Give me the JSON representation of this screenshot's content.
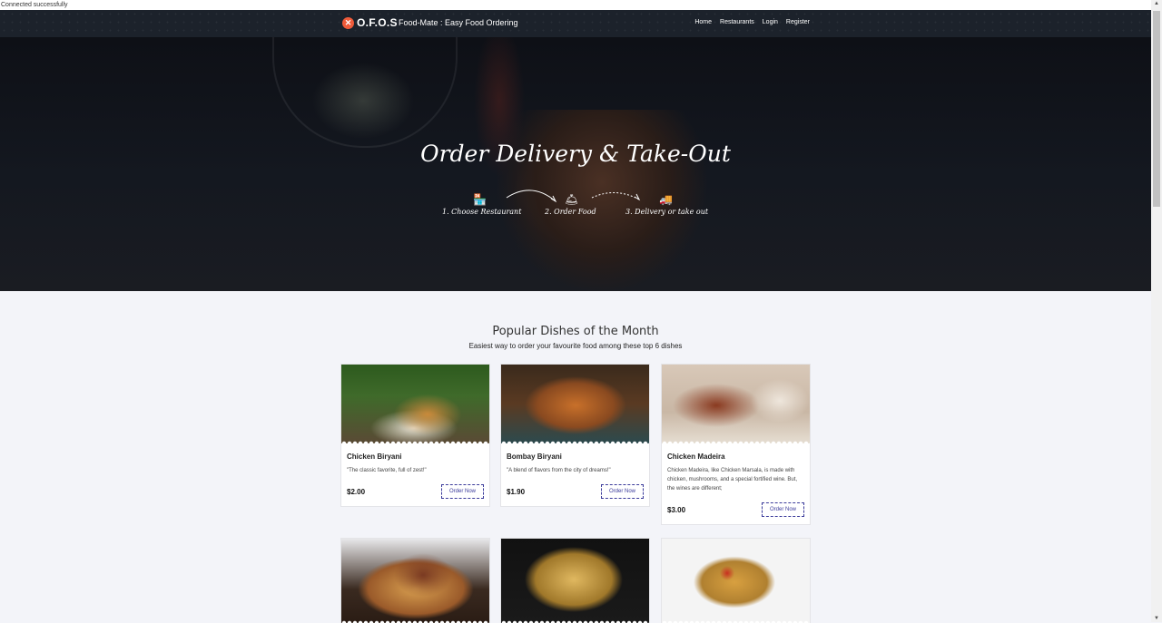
{
  "status": "Connected successfully",
  "brand": {
    "logo_text": "O.F.O.S",
    "title": "Food-Mate : Easy Food Ordering"
  },
  "nav": [
    "Home",
    "Restaurants",
    "Login",
    "Register"
  ],
  "hero": {
    "title": "Order Delivery & Take-Out",
    "steps": [
      "1. Choose Restaurant",
      "2. Order Food",
      "3. Delivery or take out"
    ]
  },
  "section": {
    "title": "Popular Dishes of the Month",
    "subtitle": "Easiest way to order your favourite food among these top 6 dishes"
  },
  "dishes": [
    {
      "name": "Chicken Biryani",
      "desc": "\"The classic favorite, full of zest!\"",
      "price": "$2.00",
      "button": "Order Now"
    },
    {
      "name": "Bombay Biryani",
      "desc": "\"A blend of flavors from the city of dreams!\"",
      "price": "$1.90",
      "button": "Order Now"
    },
    {
      "name": "Chicken Madeira",
      "desc": "Chicken Madeira, like Chicken Marsala, is made with chicken, mushrooms, and a special fortified wine. But, the wines are different;",
      "price": "$3.00",
      "button": "Order Now"
    }
  ]
}
